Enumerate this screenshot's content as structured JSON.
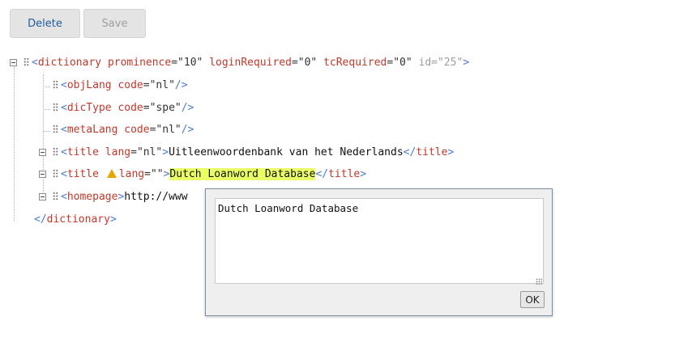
{
  "toolbar": {
    "delete_label": "Delete",
    "save_label": "Save"
  },
  "tree": {
    "root": {
      "tag": "dictionary",
      "attrs": [
        {
          "name": "prominence",
          "value": "\"10\""
        },
        {
          "name": "loginRequired",
          "value": "\"0\""
        },
        {
          "name": "tcRequired",
          "value": "\"0\""
        }
      ],
      "id_attr": "id=\"25\"",
      "close": "dictionary"
    },
    "children": [
      {
        "tag": "objLang",
        "attr": "code",
        "value": "\"nl\""
      },
      {
        "tag": "dicType",
        "attr": "code",
        "value": "\"spe\""
      },
      {
        "tag": "metaLang",
        "attr": "code",
        "value": "\"nl\""
      },
      {
        "tag": "title",
        "attr": "lang",
        "value": "\"nl\"",
        "text": "Uitleenwoordenbank van het Nederlands",
        "close": "title"
      },
      {
        "tag": "title",
        "attr": "lang",
        "value": "\"\"",
        "text": "Dutch Loanword Database",
        "close": "title"
      },
      {
        "tag": "homepage",
        "text": "http://www"
      }
    ]
  },
  "popup": {
    "text_value": "Dutch Loanword Database",
    "ok_label": "OK"
  },
  "colors": {
    "tag": "#c0392b",
    "bracket": "#4a7bd0",
    "highlight": "#eaff66",
    "warning": "#e6a800"
  }
}
